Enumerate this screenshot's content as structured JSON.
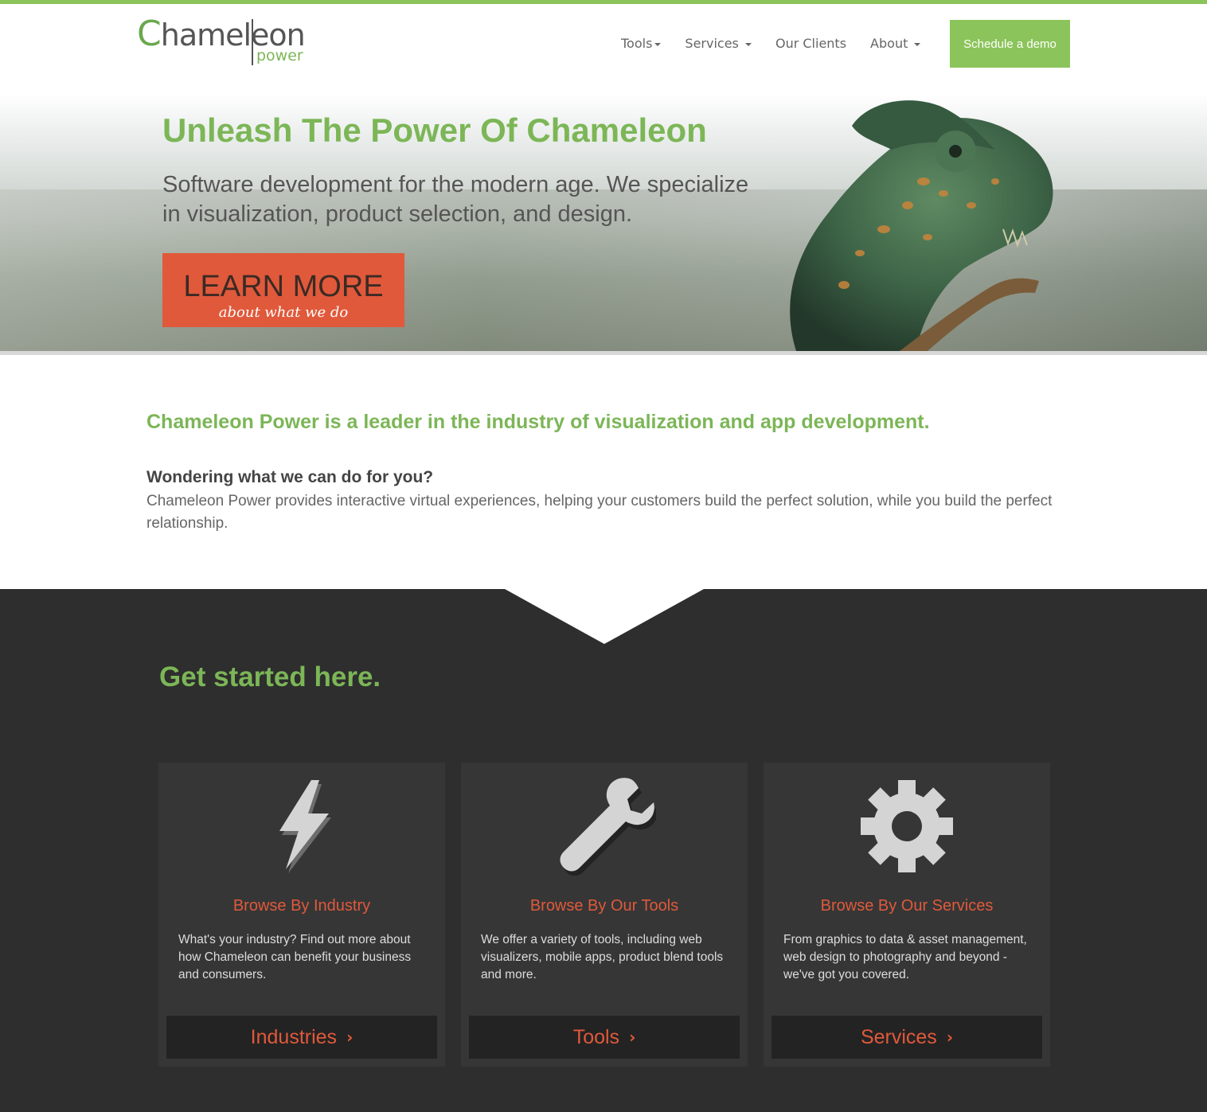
{
  "colors": {
    "brand_green": "#8bc45a",
    "accent_orange": "#e0593b",
    "dark_bg": "#2e2e2e"
  },
  "header": {
    "logo_first": "C",
    "logo_rest": "hameleon",
    "logo_sub": "power",
    "nav": [
      {
        "label": "Tools",
        "has_caret": true
      },
      {
        "label": "Services",
        "has_caret": true
      },
      {
        "label": "Our Clients",
        "has_caret": false
      },
      {
        "label": "About",
        "has_caret": true
      }
    ],
    "demo_label": "Schedule a demo"
  },
  "hero": {
    "title": "Unleash The Power Of Chameleon",
    "subtitle": "Software development for the modern age. We specialize in visualization, product selection, and design.",
    "button_big": "LEARN MORE",
    "button_small": "about what we do"
  },
  "intro": {
    "lead": "Chameleon Power is a leader in the industry of visualization and app development.",
    "question": "Wondering what we can do for you?",
    "text": "Chameleon Power provides interactive virtual experiences, helping your customers build the perfect solution, while you build the perfect relationship."
  },
  "get_started": {
    "heading": "Get started here.",
    "cards": [
      {
        "icon": "lightning-icon",
        "title": "Browse By Industry",
        "text": "What's your industry? Find out more about how Chameleon can benefit your business and consumers.",
        "button": "Industries"
      },
      {
        "icon": "wrench-icon",
        "title": "Browse By Our Tools",
        "text": "We offer a variety of tools, including web visualizers, mobile apps, product blend tools and more.",
        "button": "Tools"
      },
      {
        "icon": "gear-icon",
        "title": "Browse By Our Services",
        "text": "From graphics to data & asset management, web design to photography and beyond - we've got you covered.",
        "button": "Services"
      }
    ]
  }
}
